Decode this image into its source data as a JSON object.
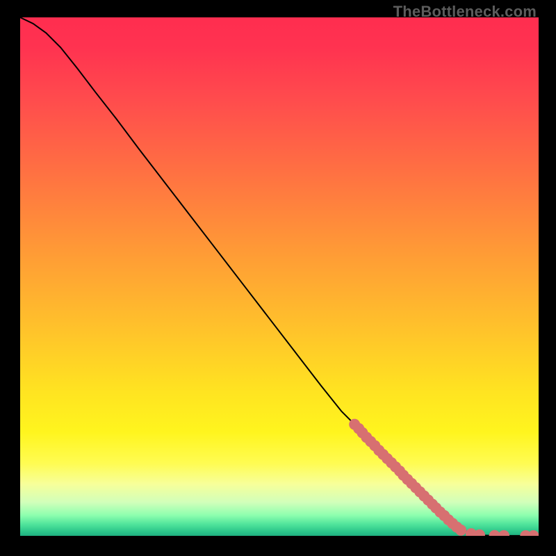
{
  "watermark": "TheBottleneck.com",
  "gradient_stops": [
    {
      "offset": 0.0,
      "color": "#ff2d4f"
    },
    {
      "offset": 0.06,
      "color": "#ff3350"
    },
    {
      "offset": 0.16,
      "color": "#ff4c4d"
    },
    {
      "offset": 0.3,
      "color": "#ff7142"
    },
    {
      "offset": 0.45,
      "color": "#ff9a36"
    },
    {
      "offset": 0.6,
      "color": "#ffc22b"
    },
    {
      "offset": 0.72,
      "color": "#ffe321"
    },
    {
      "offset": 0.8,
      "color": "#fff51e"
    },
    {
      "offset": 0.86,
      "color": "#fffc52"
    },
    {
      "offset": 0.9,
      "color": "#f7ff9a"
    },
    {
      "offset": 0.935,
      "color": "#d2ffba"
    },
    {
      "offset": 0.96,
      "color": "#8effaf"
    },
    {
      "offset": 0.978,
      "color": "#4fe39b"
    },
    {
      "offset": 0.992,
      "color": "#2bc58a"
    },
    {
      "offset": 1.0,
      "color": "#1fb080"
    }
  ],
  "chart_data": {
    "type": "line",
    "title": "",
    "xlabel": "",
    "ylabel": "",
    "xlim": [
      0,
      100
    ],
    "ylim": [
      0,
      100
    ],
    "series": [
      {
        "name": "curve",
        "style": "solid-black",
        "points": [
          {
            "x": 0.0,
            "y": 100.0
          },
          {
            "x": 2.5,
            "y": 98.8
          },
          {
            "x": 5.0,
            "y": 97.0
          },
          {
            "x": 7.8,
            "y": 94.2
          },
          {
            "x": 11.0,
            "y": 90.2
          },
          {
            "x": 14.5,
            "y": 85.6
          },
          {
            "x": 18.5,
            "y": 80.5
          },
          {
            "x": 23.0,
            "y": 74.5
          },
          {
            "x": 28.0,
            "y": 68.0
          },
          {
            "x": 33.0,
            "y": 61.5
          },
          {
            "x": 38.0,
            "y": 55.0
          },
          {
            "x": 43.0,
            "y": 48.5
          },
          {
            "x": 48.0,
            "y": 42.0
          },
          {
            "x": 53.0,
            "y": 35.5
          },
          {
            "x": 58.0,
            "y": 29.0
          },
          {
            "x": 62.0,
            "y": 24.0
          },
          {
            "x": 64.5,
            "y": 21.5
          },
          {
            "x": 67.0,
            "y": 19.0
          },
          {
            "x": 69.0,
            "y": 17.0
          },
          {
            "x": 71.0,
            "y": 15.0
          },
          {
            "x": 73.0,
            "y": 13.0
          },
          {
            "x": 75.0,
            "y": 11.0
          },
          {
            "x": 77.0,
            "y": 9.0
          },
          {
            "x": 79.0,
            "y": 7.0
          },
          {
            "x": 81.0,
            "y": 5.0
          },
          {
            "x": 83.0,
            "y": 3.0
          },
          {
            "x": 85.0,
            "y": 1.3
          },
          {
            "x": 87.0,
            "y": 0.4
          },
          {
            "x": 89.0,
            "y": 0.1
          },
          {
            "x": 91.0,
            "y": 0.05
          },
          {
            "x": 94.0,
            "y": 0.02
          },
          {
            "x": 97.0,
            "y": 0.02
          },
          {
            "x": 99.0,
            "y": 0.02
          }
        ]
      },
      {
        "name": "highlighted-points",
        "style": "pink-dots",
        "points": [
          {
            "x": 64.5,
            "y": 21.5
          },
          {
            "x": 65.3,
            "y": 20.7
          },
          {
            "x": 66.0,
            "y": 19.9
          },
          {
            "x": 66.8,
            "y": 19.0
          },
          {
            "x": 67.6,
            "y": 18.2
          },
          {
            "x": 68.4,
            "y": 17.4
          },
          {
            "x": 69.2,
            "y": 16.5
          },
          {
            "x": 70.0,
            "y": 15.7
          },
          {
            "x": 70.8,
            "y": 14.9
          },
          {
            "x": 71.6,
            "y": 14.1
          },
          {
            "x": 72.4,
            "y": 13.3
          },
          {
            "x": 73.2,
            "y": 12.5
          },
          {
            "x": 73.9,
            "y": 11.7
          },
          {
            "x": 74.7,
            "y": 10.9
          },
          {
            "x": 75.5,
            "y": 10.1
          },
          {
            "x": 76.3,
            "y": 9.3
          },
          {
            "x": 77.1,
            "y": 8.5
          },
          {
            "x": 77.9,
            "y": 7.7
          },
          {
            "x": 78.7,
            "y": 6.9
          },
          {
            "x": 79.5,
            "y": 6.1
          },
          {
            "x": 80.2,
            "y": 5.4
          },
          {
            "x": 81.0,
            "y": 4.6
          },
          {
            "x": 81.8,
            "y": 3.9
          },
          {
            "x": 82.6,
            "y": 3.1
          },
          {
            "x": 83.4,
            "y": 2.4
          },
          {
            "x": 84.2,
            "y": 1.7
          },
          {
            "x": 85.0,
            "y": 1.1
          },
          {
            "x": 87.0,
            "y": 0.4
          },
          {
            "x": 88.6,
            "y": 0.18
          },
          {
            "x": 91.5,
            "y": 0.05
          },
          {
            "x": 93.3,
            "y": 0.04
          },
          {
            "x": 97.5,
            "y": 0.02
          },
          {
            "x": 99.0,
            "y": 0.02
          }
        ]
      }
    ]
  },
  "colors": {
    "dot": "#d77071",
    "line": "#000000"
  }
}
